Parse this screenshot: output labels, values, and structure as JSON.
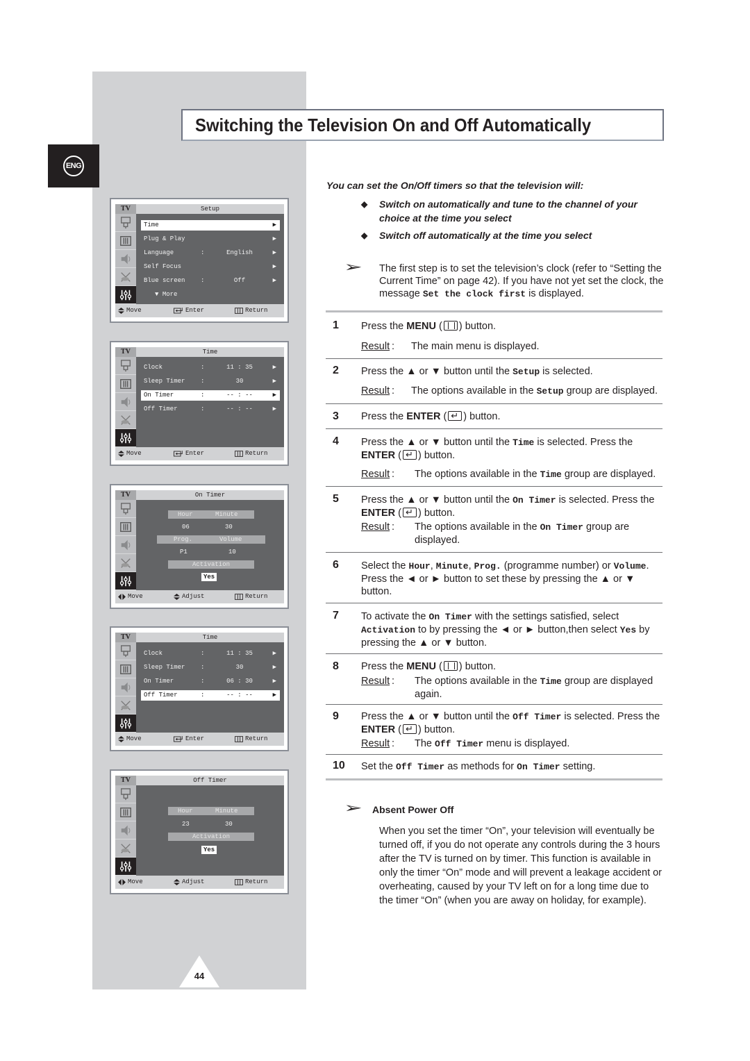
{
  "language_badge": "ENG",
  "title": "Switching the Television On and Off Automatically",
  "page_number": "44",
  "intro": {
    "lead": "You can set the On/Off timers so that the television will:",
    "bullets": [
      "Switch on automatically and tune to the channel of your choice at the time you select",
      "Switch off automatically at the time you select"
    ]
  },
  "note": {
    "text_before": "The first step is to set the television’s clock (refer to “Setting the Current Time” on page 42). If you have not yet set the clock,  the message ",
    "mono": "Set the clock first",
    "text_after": " is displayed."
  },
  "result_label": "Result",
  "steps": [
    {
      "num": "1",
      "parts": [
        "Press the ",
        "MENU",
        " (",
        "menu-key",
        ")  button."
      ],
      "result": "The main menu is displayed."
    },
    {
      "num": "2",
      "text": "Press the ▲ or ▼ button until the Setup is selected.",
      "result": "The options available in the Setup group are displayed."
    },
    {
      "num": "3",
      "text": "Press the ENTER ( ↵ ) button."
    },
    {
      "num": "4",
      "text": "Press the ▲ or ▼ button until the Time is selected. Press the ENTER ( ↵ ) button.",
      "result": "The options available in the Time group are displayed."
    },
    {
      "num": "5",
      "text": "Press the ▲ or ▼ button until the On Timer is selected. Press the ENTER ( ↵ ) button.",
      "result": "The options available in the On Timer group are displayed."
    },
    {
      "num": "6",
      "text": "Select the Hour, Minute, Prog. (programme number) or Volume. Press the ◄ or ► button to set these by pressing the ▲ or ▼ button."
    },
    {
      "num": "7",
      "text": "To activate the On Timer with the settings satisfied, select Activation to by pressing the ◄ or ► button,then select Yes by pressing the ▲ or ▼ button."
    },
    {
      "num": "8",
      "text": "Press the MENU ( Ⅱ ) button.",
      "result": "The options available in the Time group are displayed again."
    },
    {
      "num": "9",
      "text": "Press the ▲ or ▼ button until the Off Timer is selected. Press the ENTER ( ↵ ) button.",
      "result": "The Off Timer menu is displayed."
    },
    {
      "num": "10",
      "text": "Set the Off Timer as methods for On Timer setting."
    }
  ],
  "step_text": {
    "s1a": "Press the ",
    "s1b": "MENU",
    "s1c": " (",
    "s1d": ")  button.",
    "s2a": "Press the ▲ or ▼ button until the ",
    "s2m": "Setup",
    "s2b": " is selected.",
    "r2a": "The options available in the ",
    "r2m": "Setup",
    "r2b": " group are displayed.",
    "s3a": "Press the ",
    "s3b": "ENTER",
    "s3c": " (",
    "s3d": ") button.",
    "s4a": "Press the ▲ or ▼ button until the ",
    "s4m": "Time",
    "s4b": " is selected. Press the ",
    "s4c": "ENTER",
    "s4d": " (",
    "s4e": ") button.",
    "r4a": "The options available in the ",
    "r4m": "Time",
    "r4b": " group are displayed.",
    "s5a": "Press the ▲ or ▼ button until the ",
    "s5m": "On Timer",
    "s5b": " is selected. Press the ",
    "s5c": "ENTER",
    "s5d": " (",
    "s5e": ") button.",
    "r5a": "The options available in the ",
    "r5m": "On Timer",
    "r5b": " group are displayed.",
    "s6a": "Select the ",
    "s6m1": "Hour",
    "s6b": ", ",
    "s6m2": "Minute",
    "s6c": ", ",
    "s6m3": "Prog.",
    "s6d": " (programme number) or ",
    "s6m4": "Volume",
    "s6e": ". Press the ◄ or ► button to set these by pressing the ▲ or ▼ button.",
    "s7a": "To activate the ",
    "s7m1": "On Timer",
    "s7b": " with the settings satisfied, select ",
    "s7m2": "Activation",
    "s7c": " to by pressing the ◄ or ► button,then select ",
    "s7m3": "Yes",
    "s7d": " by pressing the ▲ or ▼ button.",
    "s8a": "Press the ",
    "s8b": "MENU",
    "s8c": " (",
    "s8d": ") button.",
    "r8a": "The options available in the ",
    "r8m": "Time",
    "r8b": " group are displayed again.",
    "s9a": "Press the ▲ or ▼ button until the ",
    "s9m": "Off Timer",
    "s9b": " is selected. Press the ",
    "s9c": "ENTER",
    "s9d": " (",
    "s9e": ") button.",
    "r9a": "The ",
    "r9m": "Off Timer",
    "r9b": " menu is displayed.",
    "s10a": "Set the ",
    "s10m1": "Off Timer",
    "s10b": " as methods for ",
    "s10m2": "On Timer",
    "s10c": " setting.",
    "r1": "The main menu is displayed."
  },
  "absent_power_off": {
    "title": "Absent Power Off",
    "text": "When you set the timer “On”, your television will eventually be turned off, if you do not operate any controls during the 3 hours after the TV is turned on by timer. This function is available in only the timer “On” mode and will prevent a leakage accident or overheating, caused by your TV left on for a long time due to the timer “On” (when you are away on holiday, for example)."
  },
  "osd": {
    "tv_label": "TV",
    "footer": {
      "move": "Move",
      "enter": "Enter",
      "return": "Return",
      "adjust": "Adjust"
    },
    "setup": {
      "title": "Setup",
      "items": [
        {
          "label": "Time",
          "value": "",
          "selected": true
        },
        {
          "label": "Plug & Play",
          "value": ""
        },
        {
          "label": "Language",
          "value": "English"
        },
        {
          "label": "Self Focus",
          "value": ""
        },
        {
          "label": "Blue screen",
          "value": "Off"
        }
      ],
      "more": "More"
    },
    "time1": {
      "title": "Time",
      "items": [
        {
          "label": "Clock",
          "value": "11 : 35"
        },
        {
          "label": "Sleep Timer",
          "value": "30"
        },
        {
          "label": "On Timer",
          "value": "-- : --",
          "selected": true
        },
        {
          "label": "Off Timer",
          "value": "-- : --"
        }
      ]
    },
    "on_timer": {
      "title": "On Timer",
      "hour_label": "Hour",
      "minute_label": "Minute",
      "hour": "06",
      "minute": "30",
      "prog_label": "Prog.",
      "volume_label": "Volume",
      "prog": "P1",
      "volume": "10",
      "activation_label": "Activation",
      "activation": "Yes"
    },
    "time2": {
      "title": "Time",
      "items": [
        {
          "label": "Clock",
          "value": "11 : 35"
        },
        {
          "label": "Sleep Timer",
          "value": "30"
        },
        {
          "label": "On Timer",
          "value": "06 : 30"
        },
        {
          "label": "Off Timer",
          "value": "-- : --",
          "selected": true
        }
      ]
    },
    "off_timer": {
      "title": "Off Timer",
      "hour_label": "Hour",
      "minute_label": "Minute",
      "hour": "23",
      "minute": "30",
      "activation_label": "Activation",
      "activation": "Yes"
    }
  }
}
